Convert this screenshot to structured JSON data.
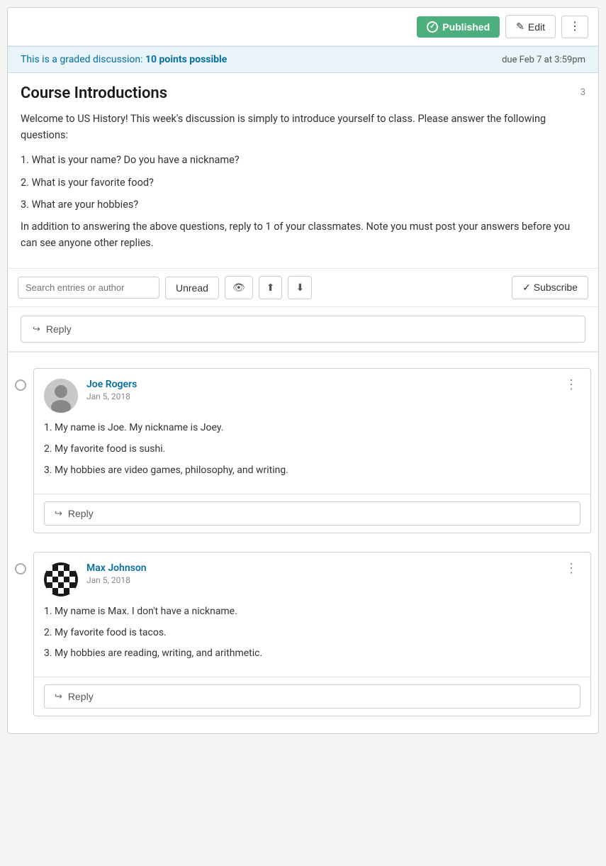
{
  "toolbar": {
    "published_label": "Published",
    "edit_label": "Edit",
    "more_icon": "⋮"
  },
  "graded_notice": {
    "left_prefix": "This is a graded discussion:",
    "points": "10 points possible",
    "due": "due Feb 7 at 3:59pm"
  },
  "discussion": {
    "title": "Course Introductions",
    "count": "3",
    "body_intro": "Welcome to US History! This week's discussion is simply to introduce yourself to class. Please answer the following questions:",
    "questions": [
      "1. What is your name? Do you have a nickname?",
      "2. What is your favorite food?",
      "3. What are your hobbies?"
    ],
    "body_note": "In addition to answering the above questions, reply to 1 of your classmates. Note you must post your answers before you can see anyone other replies."
  },
  "filter_bar": {
    "search_placeholder": "Search entries or author",
    "unread_label": "Unread",
    "subscribe_label": "✓ Subscribe"
  },
  "reply_bar": {
    "reply_label": "Reply"
  },
  "entries": [
    {
      "id": "entry-1",
      "author": "Joe Rogers",
      "date": "Jan 5, 2018",
      "lines": [
        "1. My name is Joe. My nickname is Joey.",
        "2. My favorite food is sushi.",
        "3. My hobbies are video games, philosophy, and writing."
      ],
      "avatar_type": "silhouette",
      "reply_label": "Reply"
    },
    {
      "id": "entry-2",
      "author": "Max Johnson",
      "date": "Jan 5, 2018",
      "lines": [
        "1. My name is Max. I don't have a nickname.",
        "2. My favorite food is tacos.",
        "3. My hobbies are reading, writing, and arithmetic."
      ],
      "avatar_type": "pattern",
      "reply_label": "Reply"
    }
  ]
}
